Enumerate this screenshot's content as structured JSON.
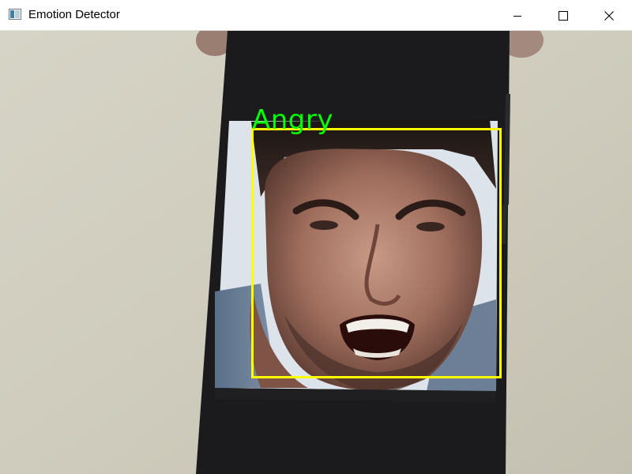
{
  "window": {
    "title": "Emotion Detector",
    "controls": {
      "minimize_icon": "minimize-icon",
      "maximize_icon": "maximize-icon",
      "close_icon": "close-icon"
    }
  },
  "detection": {
    "label": "Angry",
    "label_color": "#00ff00",
    "box_color": "#ffff00"
  }
}
